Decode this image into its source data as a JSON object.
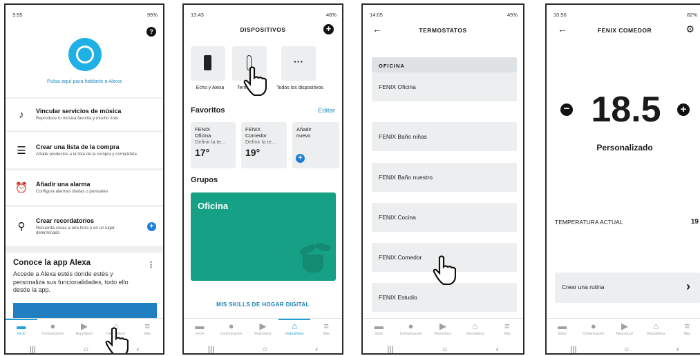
{
  "screen1": {
    "status_time": "9:55",
    "status_right": "95%",
    "alexa_prompt": "Pulsa aquí para hablarle a Alexa",
    "cards": [
      {
        "title": "Vincular servicios de música",
        "subtitle": "Reproduce tu música favorita y mucho más",
        "icon": "music-note-icon"
      },
      {
        "title": "Crear una lista de la compra",
        "subtitle": "Añade productos a la lista de la compra y compártela",
        "icon": "list-icon"
      },
      {
        "title": "Añadir una alarma",
        "subtitle": "Configura alarmas diarias o puntuales",
        "icon": "alarm-icon"
      },
      {
        "title": "Crear recordatorios",
        "subtitle": "Recuerda cosas a una hora o en un lugar determinado",
        "icon": "location-pin-icon"
      }
    ],
    "promo_title": "Conoce la app Alexa",
    "promo_text": "Accede a Alexa estés donde estés y personaliza sus funcionalidades, todo ello desde la app."
  },
  "screen2": {
    "status_time": "13:43",
    "status_right": "46%",
    "title": "DISPOSITIVOS",
    "tiles": [
      {
        "label": "Echo y Alexa",
        "icon": "echo-device-icon"
      },
      {
        "label": "Termostatos",
        "icon": "thermometer-icon"
      },
      {
        "label": "Todos los dispositivos",
        "icon": "more-dots-icon"
      }
    ],
    "favoritos_label": "Favoritos",
    "editar_label": "Editar",
    "favorites": [
      {
        "name": "FENIX Oficina",
        "sub": "Definir la te...",
        "temp": "17°"
      },
      {
        "name": "FENIX Comedor",
        "sub": "Definir la te...",
        "temp": "19°"
      },
      {
        "name": "Añadir nuevo",
        "sub": "",
        "temp": ""
      }
    ],
    "grupos_label": "Grupos",
    "group_name": "Oficina",
    "skills_link": "MIS SKILLS DE HOGAR DIGITAL"
  },
  "screen3": {
    "status_time": "14:05",
    "status_right": "45%",
    "title": "TERMOSTATOS",
    "section": "OFICINA",
    "items": [
      "FENIX Oficina",
      "FENIX Baño niñas",
      "FENIX Baño nuestro",
      "FENIX Cocina",
      "FENIX Comedor",
      "FENIX Estudio"
    ]
  },
  "screen4": {
    "status_time": "10:56",
    "status_right": "82%",
    "title": "FENIX COMEDOR",
    "setpoint": "18.5",
    "mode": "Personalizado",
    "current_temp_label": "TEMPERATURA ACTUAL",
    "current_temp_value": "19",
    "routine_label": "Crear una rutina"
  },
  "nav": {
    "items": [
      "Inicio",
      "Comunicación",
      "Reproducir",
      "Dispositivos",
      "Más"
    ]
  },
  "colors": {
    "accent": "#1ba1d8",
    "alexa": "#1fb0e6",
    "group": "#16a085",
    "plus": "#1a7fd4"
  }
}
